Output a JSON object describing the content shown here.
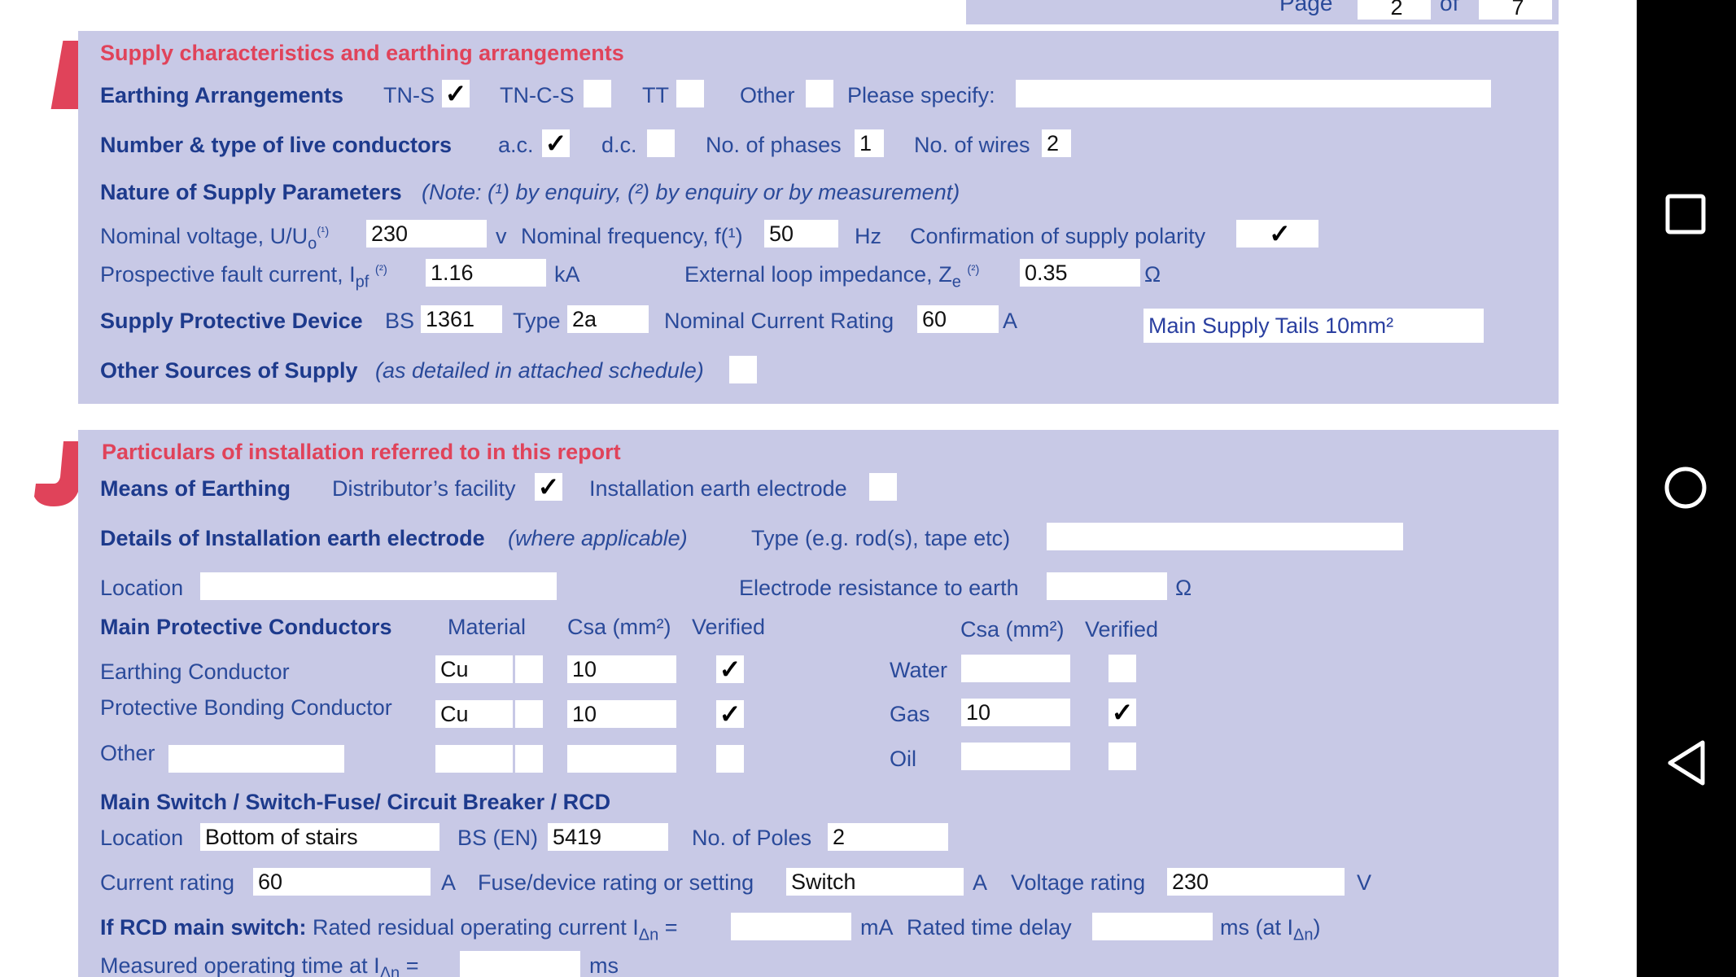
{
  "page": {
    "label": "Page",
    "number": "2",
    "of_label": "of",
    "total": "7"
  },
  "section_i": {
    "letter": "I",
    "title": "Supply characteristics and earthing arrangements",
    "earthing": {
      "label": "Earthing Arrangements",
      "tns_label": "TN-S",
      "tns_mark": "✓",
      "tncs_label": "TN-C-S",
      "tncs_mark": "",
      "tt_label": "TT",
      "tt_mark": "",
      "other_label": "Other",
      "other_mark": "",
      "specify_label": "Please specify:",
      "specify_value": ""
    },
    "conductors": {
      "label": "Number & type of live conductors",
      "ac_label": "a.c.",
      "ac_mark": "✓",
      "dc_label": "d.c.",
      "dc_mark": "",
      "phases_label": "No. of phases",
      "phases_value": "1",
      "wires_label": "No. of wires",
      "wires_value": "2"
    },
    "nature": {
      "label": "Nature of Supply Parameters",
      "note": "(Note: (¹) by enquiry, (²) by enquiry or by measurement)"
    },
    "voltage": {
      "label": "Nominal voltage, U/U",
      "sub": "o",
      "ref": "(¹)",
      "value": "230",
      "unit": "v"
    },
    "frequency": {
      "label": "Nominal frequency, f(¹)",
      "value": "50",
      "unit": "Hz"
    },
    "polarity": {
      "label": "Confirmation of supply polarity",
      "mark": "✓"
    },
    "fault_current": {
      "label": "Prospective fault current, I",
      "sub": "pf",
      "ref": "(²)",
      "value": "1.16",
      "unit": "kA"
    },
    "loop_impedance": {
      "label": "External loop impedance, Z",
      "sub": "e",
      "ref": "(²)",
      "value": "0.35",
      "unit": "Ω"
    },
    "protective_device": {
      "label": "Supply Protective Device",
      "bs_label": "BS",
      "bs_value": "1361",
      "type_label": "Type",
      "type_value": "2a",
      "rating_label": "Nominal Current Rating",
      "rating_value": "60",
      "rating_unit": "A",
      "note_value": "Main Supply Tails 10mm²"
    },
    "other_sources": {
      "label": "Other Sources of Supply",
      "note": "(as detailed in attached schedule)",
      "mark": ""
    }
  },
  "section_j": {
    "letter": "J",
    "title": "Particulars of installation referred to in this report",
    "means": {
      "label": "Means of Earthing",
      "distributor_label": "Distributor’s facility",
      "distributor_mark": "✓",
      "electrode_label": "Installation earth electrode",
      "electrode_mark": ""
    },
    "electrode_details": {
      "label": "Details of Installation earth electrode",
      "note": "(where applicable)",
      "type_label": "Type (e.g. rod(s), tape etc)",
      "type_value": "",
      "location_label": "Location",
      "location_value": "",
      "resistance_label": "Electrode resistance to earth",
      "resistance_value": "",
      "resistance_unit": "Ω"
    },
    "protective_conductors": {
      "label": "Main Protective Conductors",
      "material_header": "Material",
      "csa_header": "Csa (mm²)",
      "verified_header": "Verified",
      "right_csa_header": "Csa (mm²)",
      "right_verified_header": "Verified",
      "rows": [
        {
          "label": "Earthing Conductor",
          "material": "Cu",
          "csa": "10",
          "verified": "✓"
        },
        {
          "label": "Protective Bonding Conductor",
          "material": "Cu",
          "csa": "10",
          "verified": "✓"
        },
        {
          "label": "Other",
          "other_value": "",
          "material": "",
          "csa": "",
          "verified": ""
        }
      ],
      "services": [
        {
          "label": "Water",
          "csa": "",
          "verified": ""
        },
        {
          "label": "Gas",
          "csa": "10",
          "verified": "✓"
        },
        {
          "label": "Oil",
          "csa": "",
          "verified": ""
        }
      ]
    },
    "main_switch": {
      "label": "Main Switch / Switch-Fuse/ Circuit Breaker / RCD",
      "location_label": "Location",
      "location_value": "Bottom of stairs",
      "bs_label": "BS (EN)",
      "bs_value": "5419",
      "poles_label": "No. of Poles",
      "poles_value": "2",
      "current_label": "Current rating",
      "current_value": "60",
      "current_unit": "A",
      "fuse_label": "Fuse/device rating or setting",
      "fuse_value": "Switch",
      "fuse_unit": "A",
      "voltage_label": "Voltage rating",
      "voltage_value": "230",
      "voltage_unit": "V"
    },
    "rcd": {
      "label": "If RCD main switch:",
      "residual_label": "Rated residual operating current I",
      "residual_sub": "Δn",
      "residual_eq": "=",
      "residual_value": "",
      "residual_unit": "mA",
      "delay_label": "Rated time delay",
      "delay_value": "",
      "delay_unit": "ms (at I",
      "delay_sub": "Δn",
      "delay_close": ")",
      "measured_label": "Measured operating time at I",
      "measured_sub": "Δn",
      "measured_eq": "=",
      "measured_value": "",
      "measured_unit": "ms"
    }
  },
  "navbar": {
    "recent_icon": "square-icon",
    "home_icon": "circle-icon",
    "back_icon": "triangle-icon"
  }
}
